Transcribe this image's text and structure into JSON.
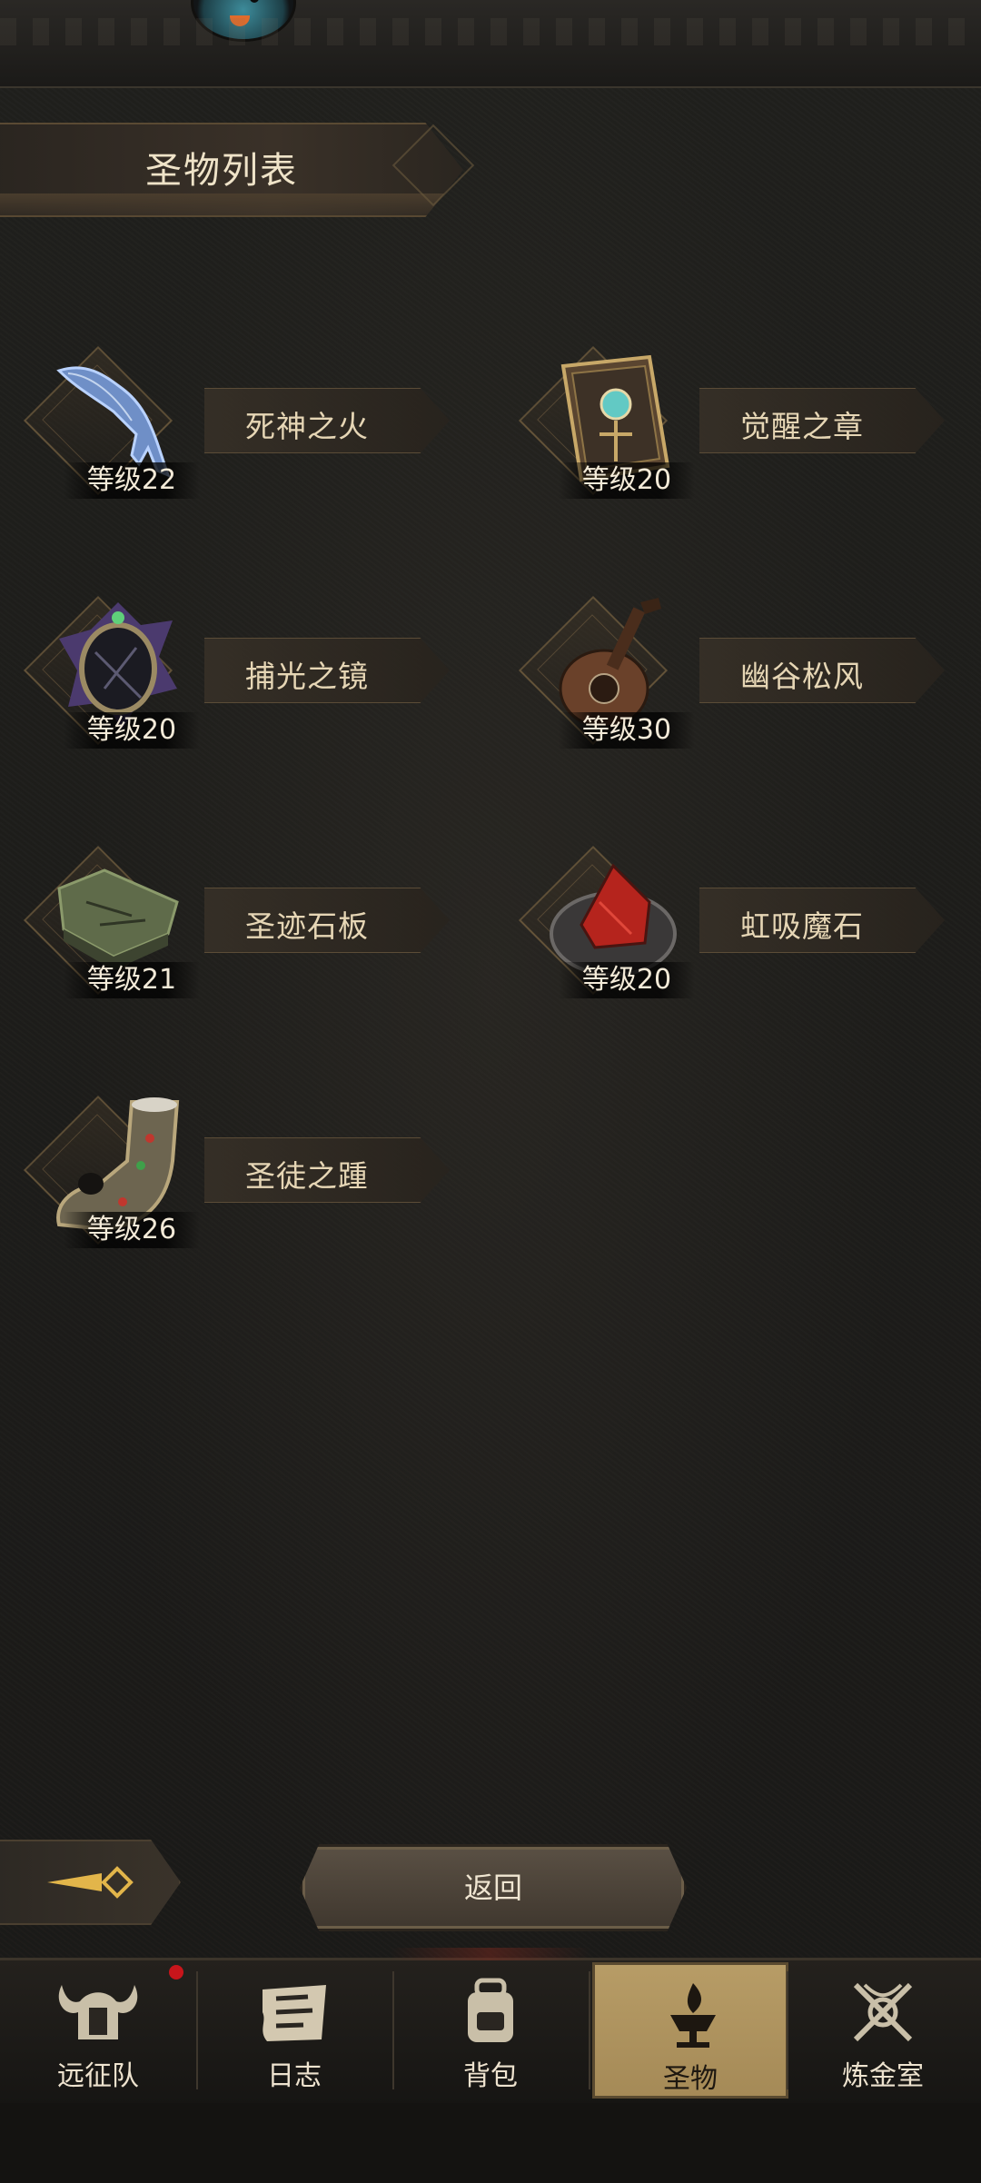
{
  "title": "圣物列表",
  "relics": [
    {
      "name": "死神之火",
      "level": "等级22",
      "icon": "spectral-claw-icon"
    },
    {
      "name": "觉醒之章",
      "level": "等级20",
      "icon": "ornate-tome-icon"
    },
    {
      "name": "捕光之镜",
      "level": "等级20",
      "icon": "crystal-mirror-icon"
    },
    {
      "name": "幽谷松风",
      "level": "等级30",
      "icon": "lute-icon"
    },
    {
      "name": "圣迹石板",
      "level": "等级21",
      "icon": "stone-tablet-icon"
    },
    {
      "name": "虹吸魔石",
      "level": "等级20",
      "icon": "red-gem-fur-icon"
    },
    {
      "name": "圣徒之踵",
      "level": "等级26",
      "icon": "jeweled-boot-icon"
    }
  ],
  "return_label": "返回",
  "tabs": [
    {
      "label": "远征队",
      "icon": "horned-helmet-icon",
      "active": false,
      "notification": true
    },
    {
      "label": "日志",
      "icon": "scroll-icon",
      "active": false
    },
    {
      "label": "背包",
      "icon": "backpack-icon",
      "active": false
    },
    {
      "label": "圣物",
      "icon": "brazier-icon",
      "active": true
    },
    {
      "label": "炼金室",
      "icon": "alchemy-symbol-icon",
      "active": false
    }
  ],
  "colors": {
    "accent_gold": "#b79c66",
    "notification": "#c8151b"
  }
}
